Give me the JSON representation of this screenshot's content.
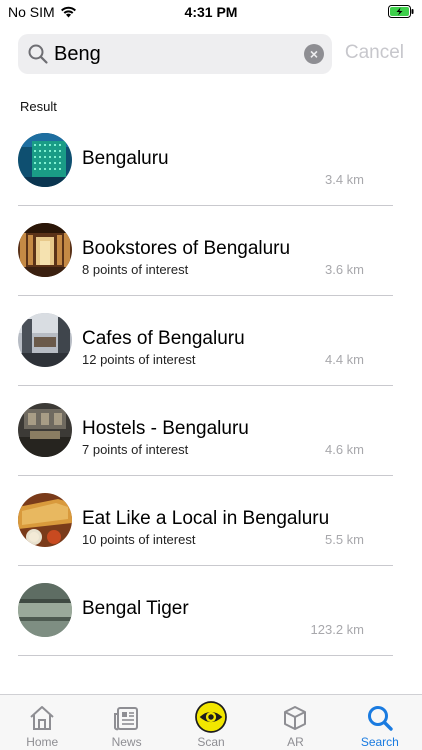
{
  "status": {
    "carrier": "No SIM",
    "time": "4:31 PM"
  },
  "search": {
    "query": "Beng",
    "cancel_label": "Cancel"
  },
  "section_label": "Result",
  "results": [
    {
      "title": "Bengaluru",
      "subtitle": "",
      "distance": "3.4 km",
      "thumb": "city-night"
    },
    {
      "title": "Bookstores of Bengaluru",
      "subtitle": "8 points of interest",
      "distance": "3.6 km",
      "thumb": "bookstore"
    },
    {
      "title": "Cafes of Bengaluru",
      "subtitle": "12 points of interest",
      "distance": "4.4 km",
      "thumb": "cafe"
    },
    {
      "title": "Hostels - Bengaluru",
      "subtitle": "7 points of interest",
      "distance": "4.6 km",
      "thumb": "hostel"
    },
    {
      "title": "Eat Like a Local in Bengaluru",
      "subtitle": "10 points of interest",
      "distance": "5.5 km",
      "thumb": "food"
    },
    {
      "title": "Bengal Tiger",
      "subtitle": "",
      "distance": "123.2 km",
      "thumb": "tiger"
    }
  ],
  "tabs": [
    {
      "label": "Home",
      "icon": "home-icon",
      "active": false
    },
    {
      "label": "News",
      "icon": "news-icon",
      "active": false
    },
    {
      "label": "Scan",
      "icon": "scan-eye-icon",
      "active": false
    },
    {
      "label": "AR",
      "icon": "ar-cube-icon",
      "active": false
    },
    {
      "label": "Search",
      "icon": "search-icon",
      "active": true
    }
  ],
  "colors": {
    "accent": "#1a7be0",
    "scan_yellow": "#f2e600",
    "battery_green": "#3ecf4b"
  }
}
